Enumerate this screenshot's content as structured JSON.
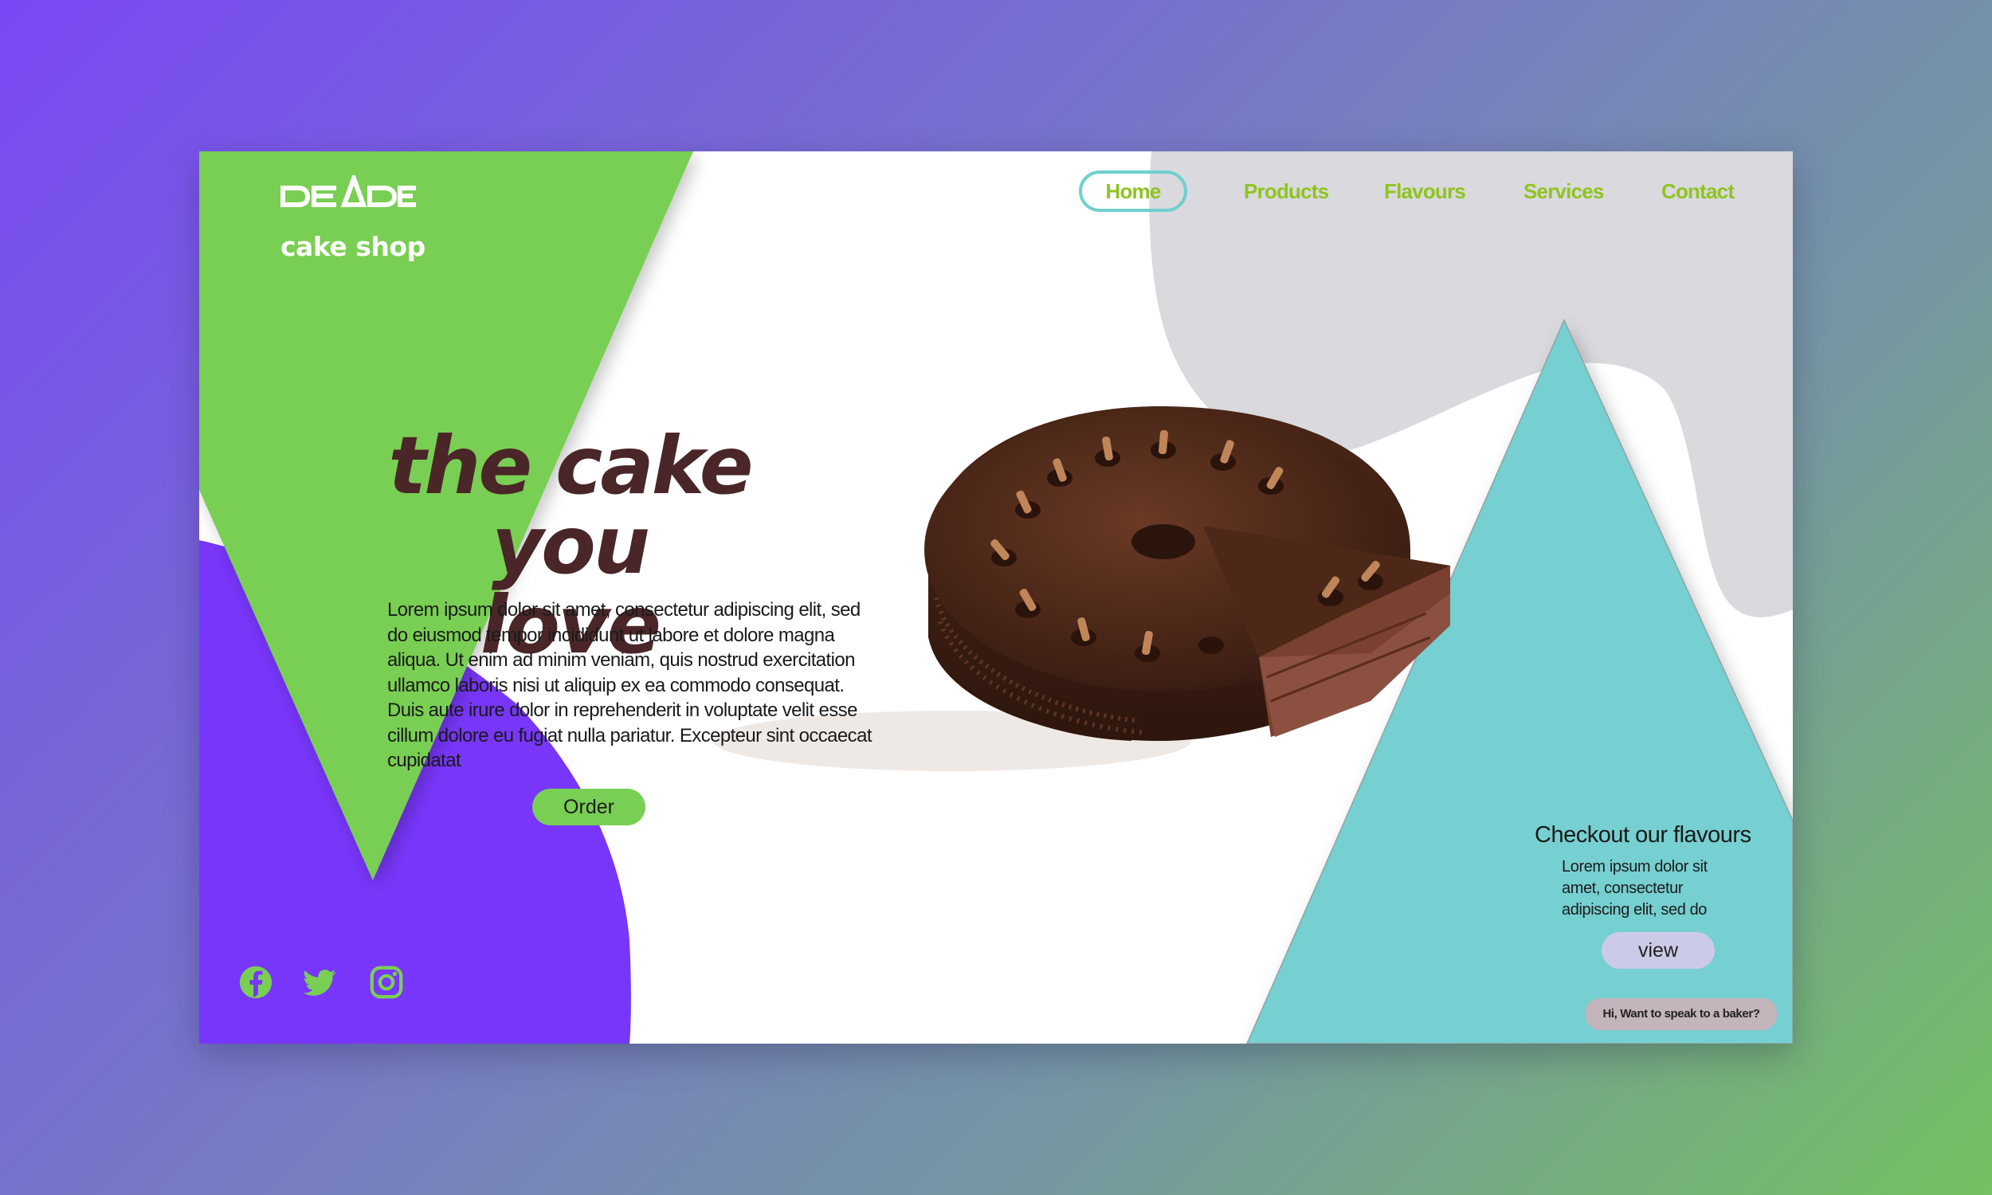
{
  "brand": {
    "logo_name": "DEADE",
    "tagline": "cake shop"
  },
  "nav": {
    "items": [
      {
        "label": "Home",
        "active": true
      },
      {
        "label": "Products"
      },
      {
        "label": "Flavours"
      },
      {
        "label": "Services"
      },
      {
        "label": "Contact"
      }
    ]
  },
  "hero": {
    "title_line1": "the cake you",
    "title_line2": "love",
    "description": "Lorem ipsum dolor sit amet, consectetur adipiscing elit, sed do eiusmod tempor incididunt ut labore et dolore magna aliqua. Ut enim ad minim veniam, quis nostrud exercitation ullamco laboris nisi ut aliquip ex ea commodo consequat. Duis aute irure dolor in reprehenderit in voluptate velit esse cillum dolore eu fugiat nulla pariatur. Excepteur sint occaecat cupidatat",
    "order_label": "Order"
  },
  "flavours": {
    "heading": "Checkout our flavours",
    "description": "Lorem ipsum dolor sit amet, consectetur adipiscing elit, sed do",
    "view_label": "view"
  },
  "chat": {
    "label": "Hi, Want to speak to a baker?"
  },
  "social": {
    "icons": [
      "facebook-icon",
      "twitter-icon",
      "instagram-icon"
    ]
  },
  "colors": {
    "green": "#79cf53",
    "purple": "#7836fa",
    "teal": "#76cfd0",
    "grey": "#d9d9de",
    "title_brown": "#4a2628",
    "nav_green": "#8fc41f",
    "home_ring": "#6fd0cf"
  }
}
